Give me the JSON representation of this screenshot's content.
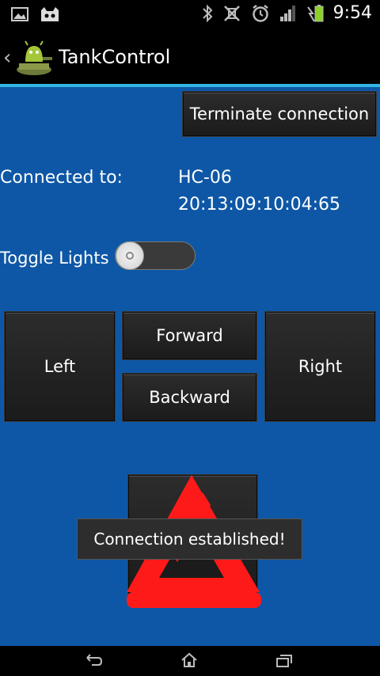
{
  "status_bar": {
    "time": "9:54",
    "icons": [
      "gallery-icon",
      "cyanogen-icon",
      "bluetooth-icon",
      "vibrate-icon",
      "alarm-icon",
      "signal-icon",
      "battery-charging-icon"
    ]
  },
  "action_bar": {
    "title": "TankControl"
  },
  "connection": {
    "terminate_label": "Terminate connection",
    "connected_label": "Connected to:",
    "device_name": "HC-06",
    "device_address": "20:13:09:10:04:65"
  },
  "lights": {
    "label": "Toggle Lights",
    "state": "off"
  },
  "controls": {
    "left": "Left",
    "forward": "Forward",
    "backward": "Backward",
    "right": "Right"
  },
  "toast": {
    "message": "Connection established!"
  },
  "colors": {
    "background": "#0e57a6",
    "accent_line": "#33b5e5",
    "warning_red": "#ff1a1a"
  }
}
